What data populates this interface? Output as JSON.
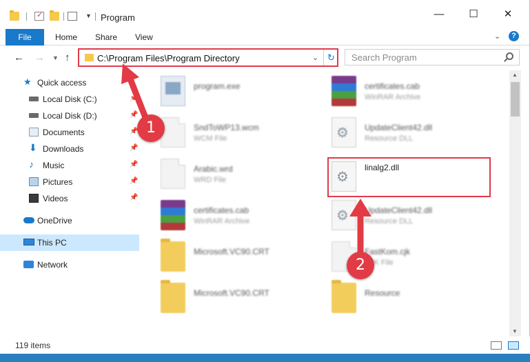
{
  "window": {
    "title": "Program",
    "controls": {
      "minimize": "—",
      "maximize": "☐",
      "close": "✕"
    }
  },
  "ribbon": {
    "tabs": [
      "File",
      "Home",
      "Share",
      "View"
    ],
    "help": "?"
  },
  "address_bar": {
    "path": "C:\\Program Files\\Program Directory",
    "search_placeholder": "Search Program"
  },
  "nav_pane": {
    "items": [
      {
        "label": "Quick access",
        "icon": "star-icon",
        "pinned": false
      },
      {
        "label": "Local Disk (C:)",
        "icon": "drive-icon",
        "pinned": true
      },
      {
        "label": "Local Disk (D:)",
        "icon": "drive-icon",
        "pinned": true
      },
      {
        "label": "Documents",
        "icon": "documents-icon",
        "pinned": true
      },
      {
        "label": "Downloads",
        "icon": "download-icon",
        "pinned": true
      },
      {
        "label": "Music",
        "icon": "music-icon",
        "pinned": true
      },
      {
        "label": "Pictures",
        "icon": "pictures-icon",
        "pinned": true
      },
      {
        "label": "Videos",
        "icon": "videos-icon",
        "pinned": true
      },
      {
        "label": "OneDrive",
        "icon": "cloud-icon",
        "pinned": false
      },
      {
        "label": "This PC",
        "icon": "computer-icon",
        "pinned": false,
        "selected": true
      },
      {
        "label": "Network",
        "icon": "network-icon",
        "pinned": false
      }
    ]
  },
  "files": [
    {
      "name": "program.exe",
      "type": "",
      "icon": "exe-icon"
    },
    {
      "name": "certificates.cab",
      "type": "WinRAR Archive",
      "icon": "rar-icon"
    },
    {
      "name": "SndToWP13.wcm",
      "type": "WCM File",
      "icon": "document-icon"
    },
    {
      "name": "UpdateClient42.dll",
      "type": "Resource DLL",
      "icon": "dll-icon"
    },
    {
      "name": "Arabic.wrd",
      "type": "WRD File",
      "icon": "document-icon"
    },
    {
      "name": "linalg2.dll",
      "type": "",
      "icon": "dll-icon",
      "highlighted": true
    },
    {
      "name": "certificates.cab",
      "type": "WinRAR Archive",
      "icon": "rar-icon"
    },
    {
      "name": "UpdateClient42.dll",
      "type": "Resource DLL",
      "icon": "dll-icon"
    },
    {
      "name": "Microsoft.VC90.CRT",
      "type": "",
      "icon": "folder-icon"
    },
    {
      "name": "FastKom.cjk",
      "type": "CJK File",
      "icon": "document-icon"
    },
    {
      "name": "Microsoft.VC90.CRT",
      "type": "",
      "icon": "folder-icon"
    },
    {
      "name": "Resource",
      "type": "",
      "icon": "folder-icon"
    }
  ],
  "status_bar": {
    "item_count": "119 items"
  },
  "annotations": [
    {
      "number": "1",
      "color": "#e23b45"
    },
    {
      "number": "2",
      "color": "#e23b45"
    }
  ]
}
